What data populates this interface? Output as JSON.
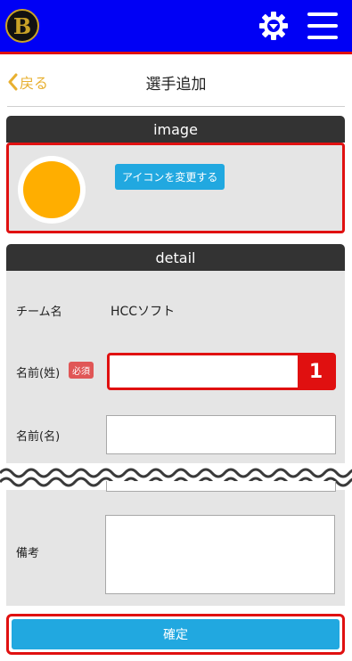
{
  "header": {
    "logo_letter": "B",
    "brand_color": "#0000f5",
    "accent_border": "#e01010",
    "icons": [
      "settings-gear-icon",
      "hamburger-menu-icon"
    ]
  },
  "nav": {
    "back_label": "戻る",
    "page_title": "選手追加"
  },
  "image_section": {
    "title": "image",
    "change_icon_label": "アイコンを変更する",
    "avatar_color": "#ffae00"
  },
  "detail_section": {
    "title": "detail",
    "team_label": "チーム名",
    "team_value": "HCCソフト",
    "last_name_label": "名前(姓)",
    "required_badge": "必須",
    "last_name_value": "",
    "first_name_label": "名前(名)",
    "first_name_value": "",
    "notes_label": "備考",
    "notes_value": ""
  },
  "annotation": {
    "step_number": "1"
  },
  "footer": {
    "confirm_label": "確定",
    "confirm_color": "#21a8e0"
  }
}
